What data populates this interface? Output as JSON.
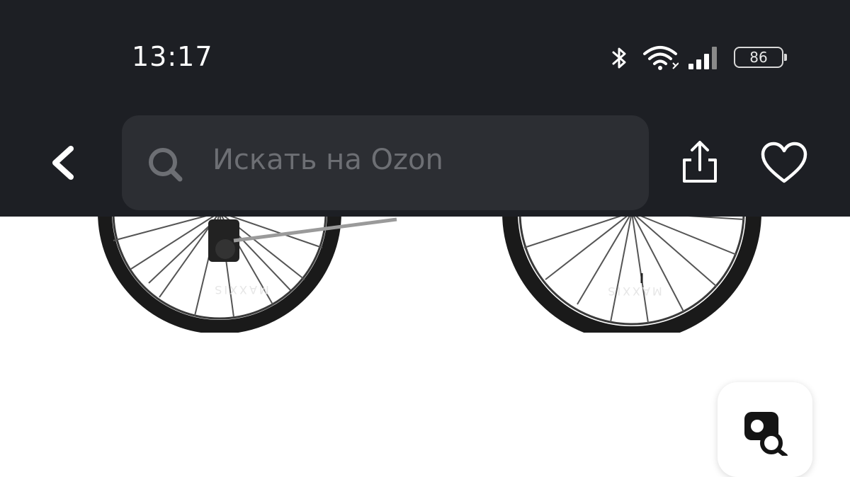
{
  "status_bar": {
    "time": "13:17",
    "battery_level": "86",
    "icons": [
      "bluetooth-icon",
      "wifi-icon",
      "signal-icon",
      "battery-icon"
    ]
  },
  "header": {
    "search_placeholder": "Искать на Ozon",
    "icons": [
      "back-arrow-icon",
      "search-icon",
      "share-icon",
      "heart-icon"
    ]
  },
  "product": {
    "tire_brand": "MAXXIS"
  },
  "fab": {
    "icon": "camera-search-icon"
  },
  "colors": {
    "header_bg": "#1d1f24",
    "search_bg": "#2c2e33",
    "placeholder": "#6d6f74",
    "page_bg": "#ffffff"
  }
}
